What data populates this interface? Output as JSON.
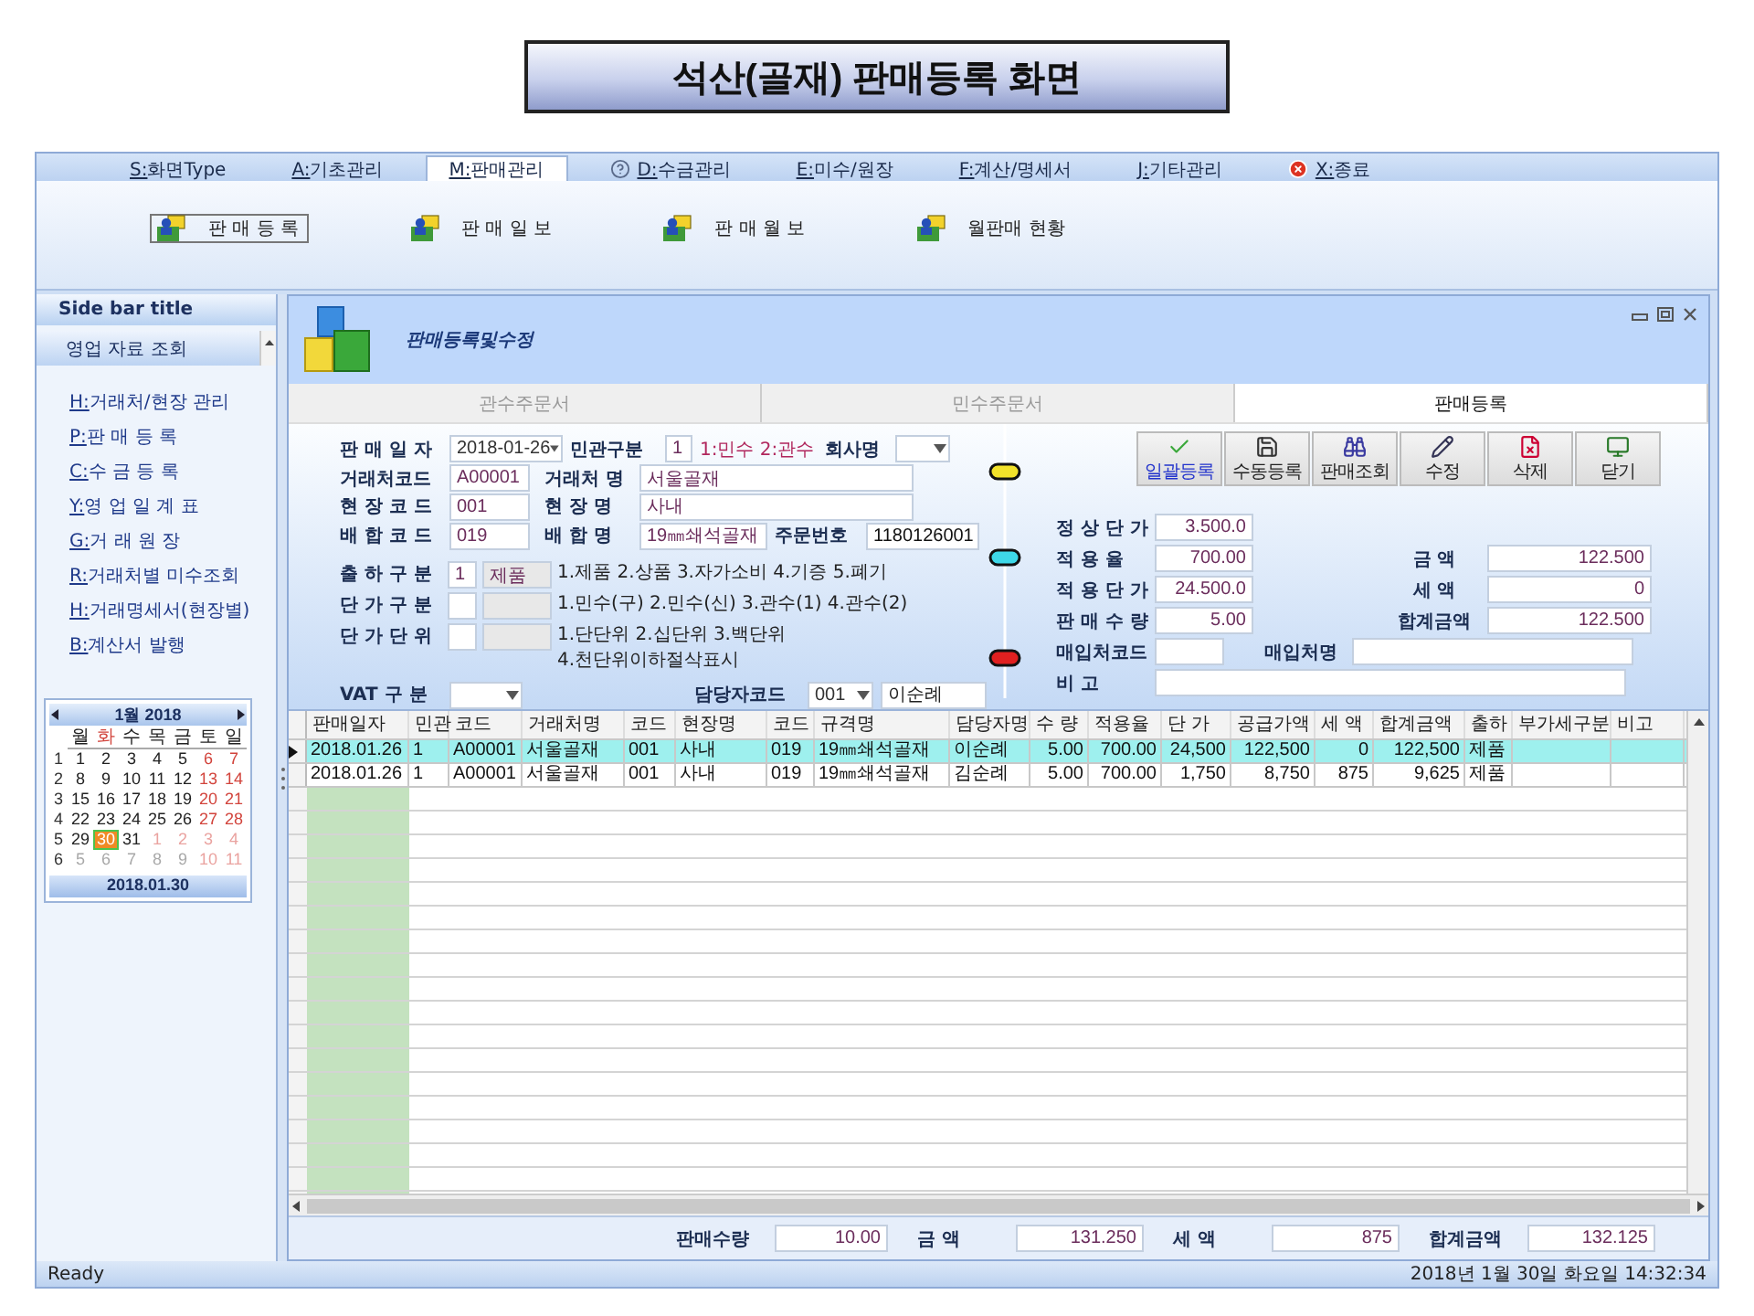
{
  "title": "석산(골재) 판매등록 화면",
  "menu": [
    {
      "label": "S:화면Type",
      "selected": false,
      "kind": "plain"
    },
    {
      "label": "A:기초관리",
      "selected": false,
      "kind": "plain"
    },
    {
      "label": "M:판매관리",
      "selected": true,
      "kind": "plain"
    },
    {
      "label": "D:수금관리",
      "selected": false,
      "kind": "help"
    },
    {
      "label": "E:미수/원장",
      "selected": false,
      "kind": "plain"
    },
    {
      "label": "F:계산/명세서",
      "selected": false,
      "kind": "plain"
    },
    {
      "label": "J:기타관리",
      "selected": false,
      "kind": "plain"
    },
    {
      "label": "X:종료",
      "selected": false,
      "kind": "exit"
    }
  ],
  "ribbon": [
    {
      "label": "판 매 등 록",
      "selected": true
    },
    {
      "label": "판 매 일 보",
      "selected": false
    },
    {
      "label": "판 매 월 보",
      "selected": false
    },
    {
      "label": "월판매 현황",
      "selected": false
    }
  ],
  "sidebar": {
    "title": "Side bar title",
    "group": "영업 자료 조회",
    "links": [
      "H:거래처/현장 관리",
      "P:판 매 등 록",
      "C:수 금 등 록",
      "Y:영 업 일 계 표",
      "G:거 래 원 장",
      "R:거래처별 미수조회",
      "H:거래명세서(현장별)",
      "B:계산서 발행"
    ]
  },
  "calendar": {
    "month": "1월 2018",
    "weekdays": [
      {
        "label": "월",
        "today": false
      },
      {
        "label": "화",
        "today": true
      },
      {
        "label": "수",
        "today": false
      },
      {
        "label": "목",
        "today": false
      },
      {
        "label": "금",
        "today": false
      },
      {
        "label": "토",
        "today": false
      },
      {
        "label": "일",
        "today": false
      }
    ],
    "weeks": [
      {
        "number": "1",
        "days": [
          {
            "day": "1",
            "kind": "weekday",
            "selected": false
          },
          {
            "day": "2",
            "kind": "weekday",
            "selected": false
          },
          {
            "day": "3",
            "kind": "weekday",
            "selected": false
          },
          {
            "day": "4",
            "kind": "weekday",
            "selected": false
          },
          {
            "day": "5",
            "kind": "weekday",
            "selected": false
          },
          {
            "day": "6",
            "kind": "weekend",
            "selected": false
          },
          {
            "day": "7",
            "kind": "weekend",
            "selected": false
          }
        ]
      },
      {
        "number": "2",
        "days": [
          {
            "day": "8",
            "kind": "weekday",
            "selected": false
          },
          {
            "day": "9",
            "kind": "weekday",
            "selected": false
          },
          {
            "day": "10",
            "kind": "weekday",
            "selected": false
          },
          {
            "day": "11",
            "kind": "weekday",
            "selected": false
          },
          {
            "day": "12",
            "kind": "weekday",
            "selected": false
          },
          {
            "day": "13",
            "kind": "weekend",
            "selected": false
          },
          {
            "day": "14",
            "kind": "weekend",
            "selected": false
          }
        ]
      },
      {
        "number": "3",
        "days": [
          {
            "day": "15",
            "kind": "weekday",
            "selected": false
          },
          {
            "day": "16",
            "kind": "weekday",
            "selected": false
          },
          {
            "day": "17",
            "kind": "weekday",
            "selected": false
          },
          {
            "day": "18",
            "kind": "weekday",
            "selected": false
          },
          {
            "day": "19",
            "kind": "weekday",
            "selected": false
          },
          {
            "day": "20",
            "kind": "weekend",
            "selected": false
          },
          {
            "day": "21",
            "kind": "weekend",
            "selected": false
          }
        ]
      },
      {
        "number": "4",
        "days": [
          {
            "day": "22",
            "kind": "weekday",
            "selected": false
          },
          {
            "day": "23",
            "kind": "weekday",
            "selected": false
          },
          {
            "day": "24",
            "kind": "weekday",
            "selected": false
          },
          {
            "day": "25",
            "kind": "weekday",
            "selected": false
          },
          {
            "day": "26",
            "kind": "weekday",
            "selected": false
          },
          {
            "day": "27",
            "kind": "weekend",
            "selected": false
          },
          {
            "day": "28",
            "kind": "weekend",
            "selected": false
          }
        ]
      },
      {
        "number": "5",
        "days": [
          {
            "day": "29",
            "kind": "weekday",
            "selected": false
          },
          {
            "day": "30",
            "kind": "weekday",
            "selected": true
          },
          {
            "day": "31",
            "kind": "weekday",
            "selected": false
          },
          {
            "day": "1",
            "kind": "other-weekend",
            "selected": false
          },
          {
            "day": "2",
            "kind": "other-weekend",
            "selected": false
          },
          {
            "day": "3",
            "kind": "other-weekend",
            "selected": false
          },
          {
            "day": "4",
            "kind": "other-weekend",
            "selected": false
          }
        ]
      },
      {
        "number": "6",
        "days": [
          {
            "day": "5",
            "kind": "other",
            "selected": false
          },
          {
            "day": "6",
            "kind": "other",
            "selected": false
          },
          {
            "day": "7",
            "kind": "other",
            "selected": false
          },
          {
            "day": "8",
            "kind": "other",
            "selected": false
          },
          {
            "day": "9",
            "kind": "other",
            "selected": false
          },
          {
            "day": "10",
            "kind": "other-weekend",
            "selected": false
          },
          {
            "day": "11",
            "kind": "other-weekend",
            "selected": false
          }
        ]
      }
    ],
    "footer": "2018.01.30"
  },
  "panel": {
    "title": "판매등록및수정",
    "tabs": [
      {
        "label": "관수주문서",
        "selected": false
      },
      {
        "label": "민수주문서",
        "selected": false
      },
      {
        "label": "판매등록",
        "selected": true
      }
    ]
  },
  "form": {
    "sale_date": {
      "label": "판 매 일 자",
      "value": "2018-01-26"
    },
    "sector": {
      "label": "민관구분",
      "value": "1",
      "hint": "1:민수 2:관수"
    },
    "company": {
      "label": "회사명"
    },
    "customer": {
      "code_label": "거래처코드",
      "code": "A00001",
      "name_label": "거래처 명",
      "name": "서울골재"
    },
    "site": {
      "code_label": "현 장 코 드",
      "code": "001",
      "name_label": "현 장 명",
      "name": "사내"
    },
    "mix": {
      "code_label": "배 합 코 드",
      "code": "019",
      "name_label": "배 합 명",
      "name": "19㎜쇄석골재"
    },
    "order": {
      "label": "주문번호",
      "value": "1180126001"
    },
    "options": [
      {
        "label": "출 하 구 분",
        "code": "1",
        "name": "제품",
        "notes": [
          "1.제품 2.상품 3.자가소비 4.기증 5.폐기"
        ]
      },
      {
        "label": "단 가 구 분",
        "notes": [
          "1.민수(구) 2.민수(신) 3.관수(1) 4.관수(2)"
        ]
      },
      {
        "label": "단 가 단 위",
        "notes": [
          "1.단단위 2.십단위 3.백단위",
          "4.천단위이하절삭표시"
        ]
      }
    ],
    "vat": {
      "label": "VAT 구 분"
    },
    "manager": {
      "label": "담당자코드",
      "code": "001",
      "name": "이순례"
    }
  },
  "actions": [
    {
      "label": "일괄등록",
      "kind": "check",
      "active": true
    },
    {
      "label": "수동등록",
      "kind": "save",
      "active": false
    },
    {
      "label": "판매조회",
      "kind": "search",
      "active": false
    },
    {
      "label": "수정",
      "kind": "edit",
      "active": false
    },
    {
      "label": "삭제",
      "kind": "delete",
      "active": false
    },
    {
      "label": "닫기",
      "kind": "exit",
      "active": false
    }
  ],
  "amounts": {
    "prices": [
      {
        "label": "정 상 단 가",
        "value": "3.500.0"
      },
      {
        "label": "적 용 율",
        "value": "700.00"
      },
      {
        "label": "적 용 단 가",
        "value": "24.500.0"
      },
      {
        "label": "판 매 수 량",
        "value": "5.00"
      }
    ],
    "sums": [
      {
        "label": "금 액",
        "value": "122.500"
      },
      {
        "label": "세 액",
        "value": "0"
      },
      {
        "label": "합계금액",
        "value": "122.500"
      }
    ],
    "supplier": {
      "code_label": "매입처코드",
      "name_label": "매입처명"
    },
    "note": {
      "label": "비 고"
    }
  },
  "grid": {
    "columns": [
      "판매일자",
      "민관",
      "코드",
      "거래처명",
      "코드",
      "현장명",
      "코드",
      "규격명",
      "담당자명",
      "수 량",
      "적용율",
      "단 가",
      "공급가액",
      "세 액",
      "합계금액",
      "출하",
      "부가세구분",
      "비고"
    ],
    "rows": [
      {
        "selected": true,
        "cells": [
          "2018.01.26",
          "1",
          "A00001",
          "서울골재",
          "001",
          "사내",
          "019",
          "19㎜쇄석골재",
          "이순례",
          "5.00",
          "700.00",
          "24,500",
          "122,500",
          "0",
          "122,500",
          "제품"
        ]
      },
      {
        "selected": false,
        "cells": [
          "2018.01.26",
          "1",
          "A00001",
          "서울골재",
          "001",
          "사내",
          "019",
          "19㎜쇄석골재",
          "김순례",
          "5.00",
          "700.00",
          "1,750",
          "8,750",
          "875",
          "9,625",
          "제품"
        ]
      }
    ]
  },
  "totals": [
    {
      "label": "판매수량",
      "value": "10.00"
    },
    {
      "label": "금 액",
      "value": "131.250"
    },
    {
      "label": "세 액",
      "value": "875"
    },
    {
      "label": "합계금액",
      "value": "132.125"
    }
  ],
  "status": {
    "text": "Ready",
    "datetime": "2018년 1월 30일 화요일 14:32:34"
  }
}
